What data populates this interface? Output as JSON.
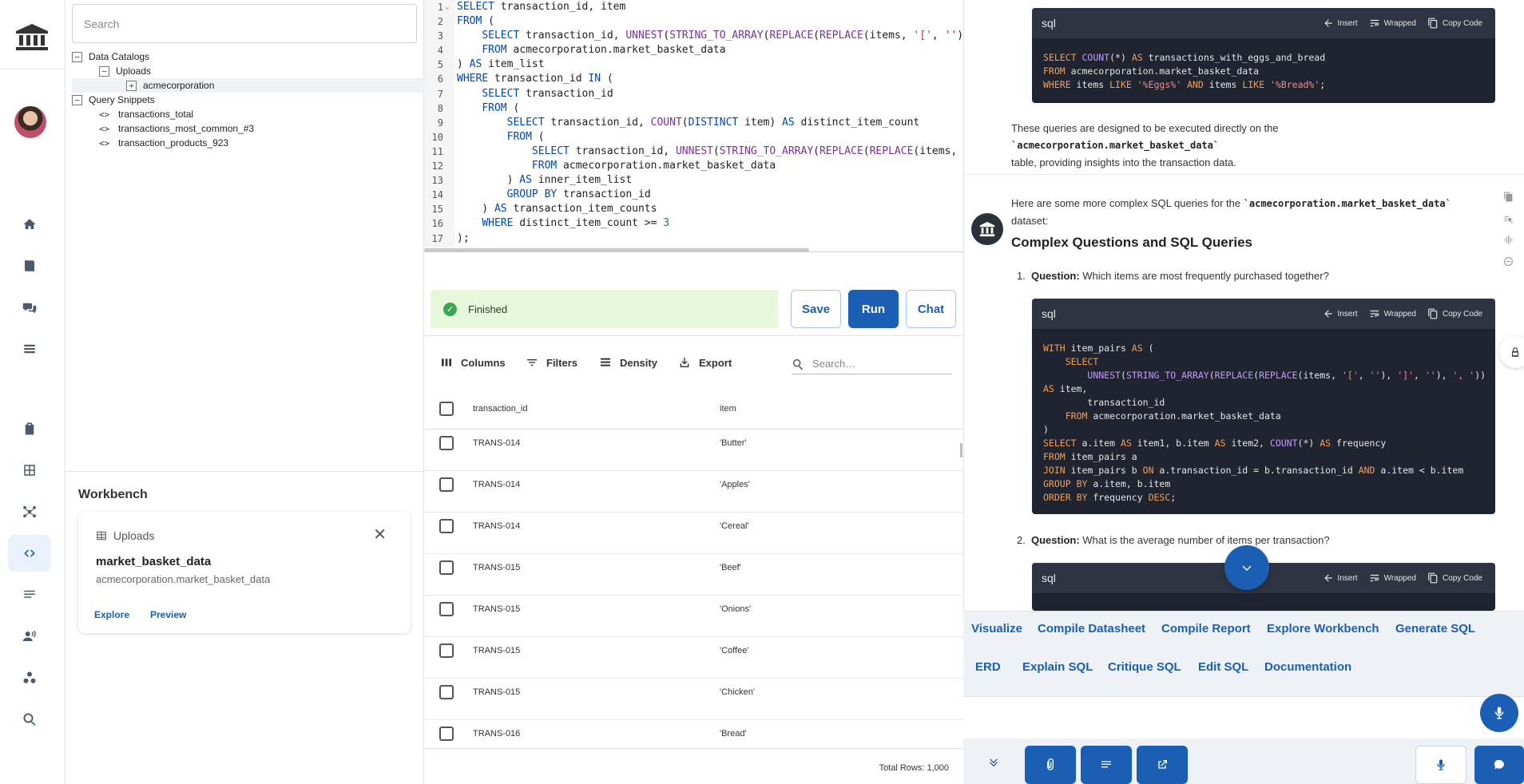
{
  "explorer": {
    "search_placeholder": "Search",
    "tree": {
      "data_catalogs": "Data Catalogs",
      "uploads": "Uploads",
      "acmecorporation": "acmecorporation",
      "query_snippets": "Query Snippets",
      "snippets": [
        "transactions_total",
        "transactions_most_common_#3",
        "transaction_products_923"
      ]
    }
  },
  "workbench": {
    "title": "Workbench",
    "kind": "Uploads",
    "name": "market_basket_data",
    "path": "acmecorporation.market_basket_data",
    "explore": "Explore",
    "preview": "Preview"
  },
  "editor": {
    "lines": [
      "SELECT transaction_id, item",
      "FROM (",
      "    SELECT transaction_id, UNNEST(STRING_TO_ARRAY(REPLACE(REPLACE(items, '[', '')",
      "    FROM acmecorporation.market_basket_data",
      ") AS item_list",
      "WHERE transaction_id IN (",
      "    SELECT transaction_id",
      "    FROM (",
      "        SELECT transaction_id, COUNT(DISTINCT item) AS distinct_item_count",
      "        FROM (",
      "            SELECT transaction_id, UNNEST(STRING_TO_ARRAY(REPLACE(REPLACE(items,",
      "            FROM acmecorporation.market_basket_data",
      "        ) AS inner_item_list",
      "        GROUP BY transaction_id",
      "    ) AS transaction_item_counts",
      "    WHERE distinct_item_count >= 3",
      ");"
    ]
  },
  "status": {
    "text": "Finished",
    "save": "Save",
    "run": "Run",
    "chat": "Chat"
  },
  "grid": {
    "tools": {
      "columns": "Columns",
      "filters": "Filters",
      "density": "Density",
      "export": "Export"
    },
    "search_placeholder": "Search…",
    "headers": [
      "transaction_id",
      "item"
    ],
    "rows": [
      [
        "TRANS-014",
        "'Butter'"
      ],
      [
        "TRANS-014",
        "'Apples'"
      ],
      [
        "TRANS-014",
        "'Cereal'"
      ],
      [
        "TRANS-015",
        "'Beef'"
      ],
      [
        "TRANS-015",
        "'Onions'"
      ],
      [
        "TRANS-015",
        "'Coffee'"
      ],
      [
        "TRANS-015",
        "'Chicken'"
      ],
      [
        "TRANS-016",
        "'Bread'"
      ]
    ],
    "total": "Total Rows: 1,000"
  },
  "chat": {
    "code_tools": {
      "lang": "sql",
      "insert": "Insert",
      "wrapped": "Wrapped",
      "copy": "Copy Code"
    },
    "block1": [
      "SELECT COUNT(*) AS transactions_with_eggs_and_bread",
      "FROM acmecorporation.market_basket_data",
      "WHERE items LIKE '%Eggs%' AND items LIKE '%Bread%';"
    ],
    "para1_a": "These queries are designed to be executed directly on the ",
    "para1_code": "`acmecorporation.market_basket_data`",
    "para1_b": "table, providing insights into the transaction data.",
    "para2_a": "Here are some more complex SQL queries for the ",
    "para2_code": "`acmecorporation.market_basket_data`",
    "para2_b": " dataset:",
    "heading": "Complex Questions and SQL Queries",
    "q1_num": "1.",
    "q1_label": "Question:",
    "q1_text": " Which items are most frequently purchased together?",
    "block2": [
      "WITH item_pairs AS (",
      "    SELECT",
      "        UNNEST(STRING_TO_ARRAY(REPLACE(REPLACE(items, '[', ''), ']', ''), ', '))",
      "AS item,",
      "        transaction_id",
      "    FROM acmecorporation.market_basket_data",
      ")",
      "SELECT a.item AS item1, b.item AS item2, COUNT(*) AS frequency",
      "FROM item_pairs a",
      "JOIN item_pairs b ON a.transaction_id = b.transaction_id AND a.item < b.item",
      "GROUP BY a.item, b.item",
      "ORDER BY frequency DESC;"
    ],
    "q2_num": "2.",
    "q2_label": "Question:",
    "q2_text": " What is the average number of items per transaction?"
  },
  "actions": {
    "row1": [
      "Visualize",
      "Compile Datasheet",
      "Compile Report",
      "Explore Workbench",
      "Generate SQL"
    ],
    "row2": [
      "ERD",
      "Explain SQL",
      "Critique SQL",
      "Edit SQL",
      "Documentation"
    ]
  },
  "colors": {
    "accent": "#1a5fb4",
    "success_bg": "#e7f7d9",
    "code_bg": "#1f2430"
  }
}
